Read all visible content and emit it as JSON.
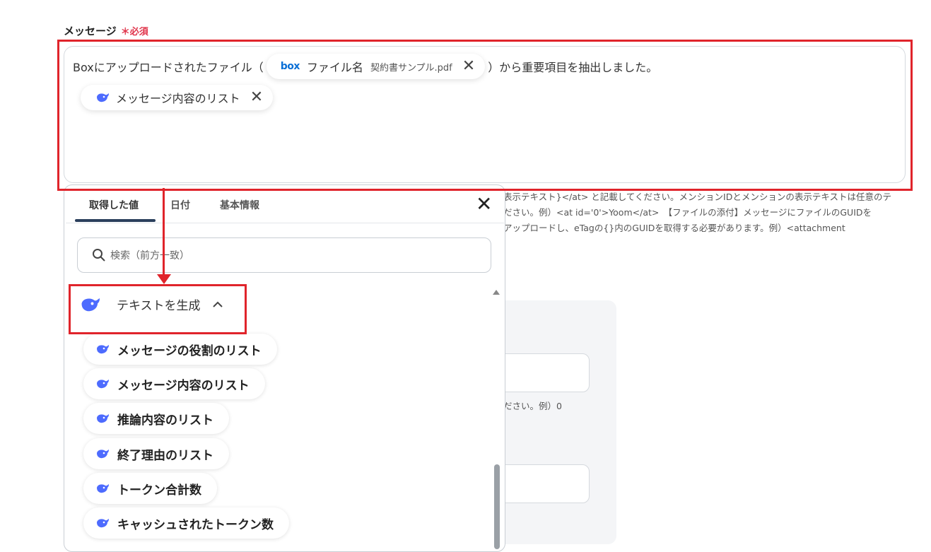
{
  "field": {
    "label": "メッセージ",
    "required": "必須"
  },
  "message": {
    "prefix": "Boxにアップロードされたファイル（",
    "box_pill": {
      "logo": "box",
      "label": "ファイル名",
      "sub": "契約書サンプル.pdf"
    },
    "suffix": "）から重要項目を抽出しました。",
    "list_pill": {
      "label": "メッセージ内容のリスト"
    }
  },
  "help": {
    "line1": "表示テキスト}</at> と記載してください。メンションIDとメンションの表示テキストは任意のテ",
    "line2": "ださい。例）<at id='0'>Yoom</at>　【ファイルの添付】メッセージにファイルのGUIDを",
    "line3": "アップロードし、eTagの{}内のGUIDを取得する必要があります。例）<attachment",
    "line4": "ださい。例）0"
  },
  "panel": {
    "tabs": [
      "取得した値",
      "日付",
      "基本情報"
    ],
    "close": "×",
    "search_placeholder": "検索（前方一致）",
    "group": {
      "label": "テキストを生成",
      "chevron": "^"
    },
    "items": [
      "メッセージの役割のリスト",
      "メッセージ内容のリスト",
      "推論内容のリスト",
      "終了理由のリスト",
      "トークン合計数",
      "キャッシュされたトークン数"
    ]
  },
  "colors": {
    "accent_red": "#e0242b",
    "required_red": "#e0354b",
    "whale_blue": "#4d6bfe",
    "box_blue": "#0a6fd6"
  }
}
